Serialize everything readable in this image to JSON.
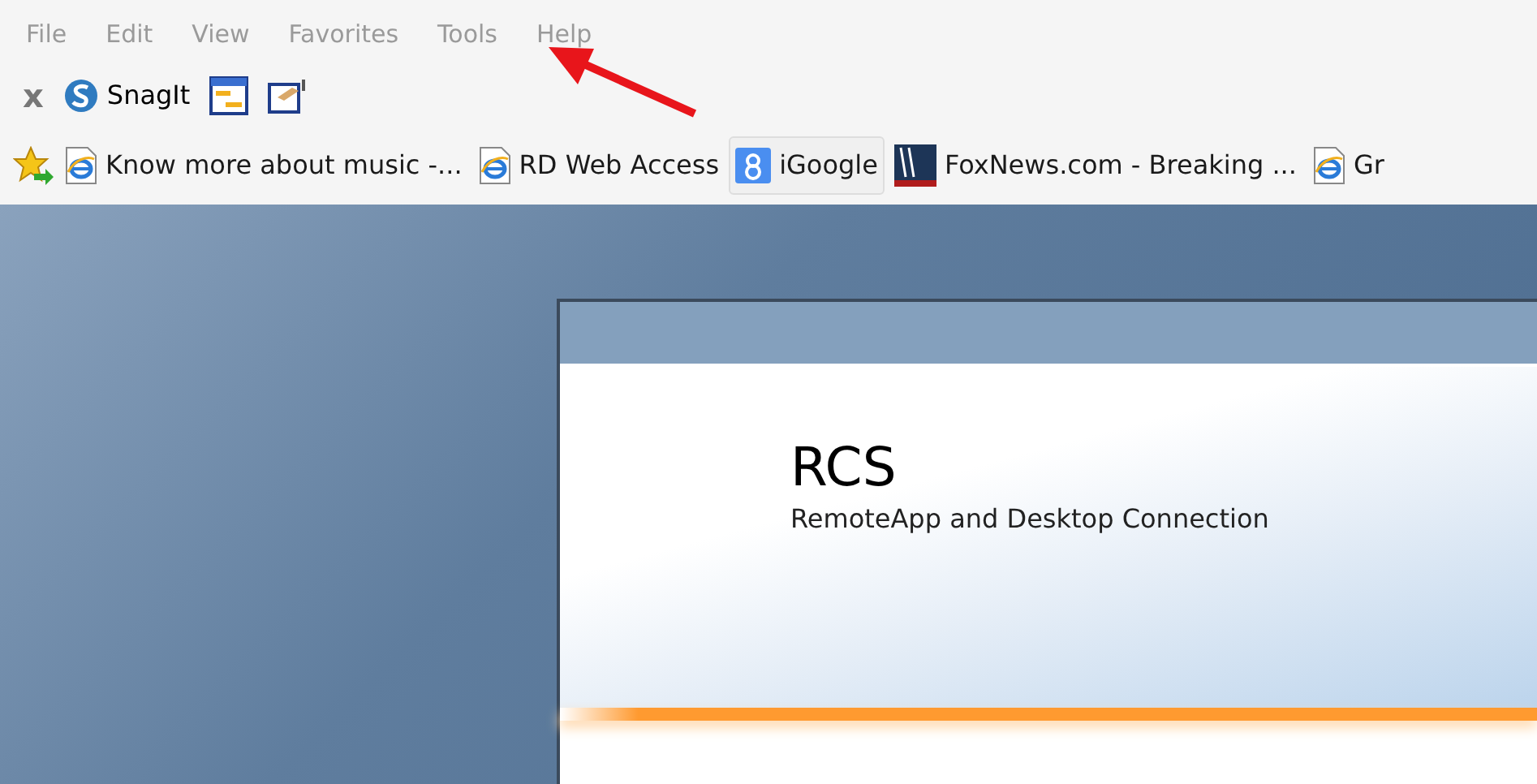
{
  "menu_bar": {
    "items": [
      "File",
      "Edit",
      "View",
      "Favorites",
      "Tools",
      "Help"
    ]
  },
  "toolbar": {
    "items": [
      {
        "kind": "close",
        "label": "x"
      },
      {
        "kind": "snagit",
        "label": "SnagIt"
      },
      {
        "kind": "window"
      },
      {
        "kind": "note"
      }
    ]
  },
  "favorites_bar": {
    "items": [
      {
        "kind": "ie",
        "label": "Know more about music -...",
        "selected": false
      },
      {
        "kind": "ie",
        "label": "RD Web Access",
        "selected": false
      },
      {
        "kind": "google",
        "label": "iGoogle",
        "selected": true
      },
      {
        "kind": "fox",
        "label": "FoxNews.com - Breaking ...",
        "selected": false
      },
      {
        "kind": "ie",
        "label": "Gr",
        "selected": false
      }
    ]
  },
  "page": {
    "title": "RCS",
    "subtitle": "RemoteApp and Desktop Connection"
  }
}
